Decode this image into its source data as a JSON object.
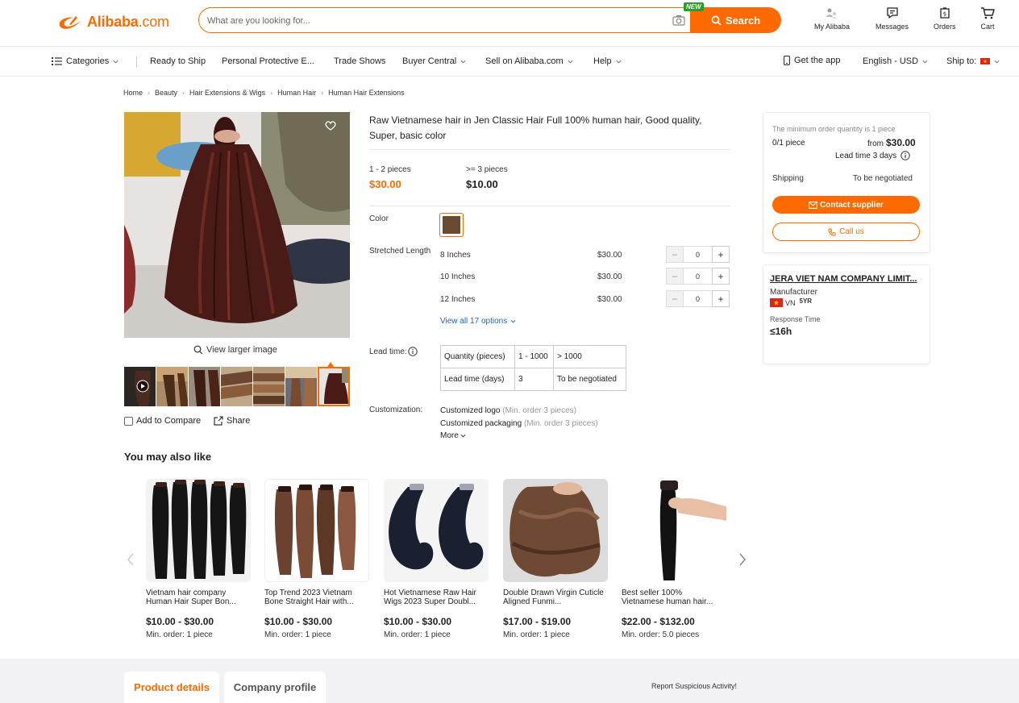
{
  "header": {
    "logo_main": "Alibaba",
    "logo_suffix": ".com",
    "search_placeholder": "What are you looking for...",
    "new_badge": "NEW",
    "search_button": "Search",
    "my_alibaba": "My Alibaba",
    "messages": "Messages",
    "orders": "Orders",
    "cart": "Cart"
  },
  "nav": {
    "categories": "Categories",
    "ready_to_ship": "Ready to Ship",
    "ppe": "Personal Protective E...",
    "trade_shows": "Trade Shows",
    "buyer_central": "Buyer Central",
    "sell": "Sell on Alibaba.com",
    "help": "Help",
    "get_app": "Get the app",
    "language": "English - USD",
    "ship_to": "Ship to:"
  },
  "breadcrumb": [
    "Home",
    "Beauty",
    "Hair Extensions & Wigs",
    "Human Hair",
    "Human Hair Extensions"
  ],
  "product": {
    "title": "Raw Vietnamese hair in Jen Classic Hair Full 100% human hair, Good quality, Super, basic color",
    "view_larger": "View larger image",
    "add_to_compare": "Add to Compare",
    "share": "Share",
    "tiers": [
      {
        "range": "1 - 2 pieces",
        "price": "$30.00"
      },
      {
        "range": ">= 3 pieces",
        "price": "$10.00"
      }
    ],
    "color_label": "Color",
    "length_label": "Stretched Length",
    "variants": [
      {
        "name": "8 Inches",
        "price": "$30.00",
        "qty": "0"
      },
      {
        "name": "10 Inches",
        "price": "$30.00",
        "qty": "0"
      },
      {
        "name": "12 Inches",
        "price": "$30.00",
        "qty": "0"
      }
    ],
    "view_all": "View all 17 options",
    "lead_time_label": "Lead time:",
    "lead_table": [
      [
        "Quantity (pieces)",
        "1 - 1000",
        "> 1000"
      ],
      [
        "Lead time (days)",
        "3",
        "To be negotiated"
      ]
    ],
    "customization_label": "Customization:",
    "customization": [
      {
        "name": "Customized logo",
        "min": "(Min. order 3 pieces)"
      },
      {
        "name": "Customized packaging",
        "min": "(Min. order 3 pieces)"
      }
    ],
    "more": "More"
  },
  "order_card": {
    "moq_note": "The minimum order quantity is 1 piece",
    "qty": "0/1 piece",
    "from_label": "from",
    "from_price": "$30.00",
    "lead_time": "Lead time 3 days",
    "shipping_label": "Shipping",
    "shipping_value": "To be negotiated",
    "contact": "Contact supplier",
    "call": "Call us"
  },
  "supplier": {
    "name": "JERA VIET NAM COMPANY LIMIT...",
    "type": "Manufacturer",
    "country": "VN",
    "years": "5YR",
    "response_label": "Response Time",
    "response_value": "≤16h"
  },
  "recommendations": {
    "title": "You may also like",
    "items": [
      {
        "title": "Vietnam hair company Human Hair Super Bon...",
        "price": "$10.00 - $30.00",
        "moq": "Min. order: 1 piece"
      },
      {
        "title": "Top Trend 2023 Vietnam Bone Straight Hair with...",
        "price": "$10.00 - $30.00",
        "moq": "Min. order: 1 piece"
      },
      {
        "title": "Hot Vietnamese Raw Hair Wigs 2023 Super Doubl...",
        "price": "$10.00 - $30.00",
        "moq": "Min. order: 1 piece"
      },
      {
        "title": "Double Drawn Virgin Cuticle Aligned Funmi...",
        "price": "$17.00 - $19.00",
        "moq": "Min. order: 1 piece"
      },
      {
        "title": "Best seller 100% Vietnamese human hair...",
        "price": "$22.00 - $132.00",
        "moq": "Min. order: 5.0 pieces"
      }
    ]
  },
  "bottom": {
    "tab_details": "Product details",
    "tab_company": "Company profile",
    "report": "Report Suspicious Activity!"
  },
  "colors": {
    "accent": "#ff6a00",
    "link": "#1a66c6",
    "hair_swatch": "#6b4a32"
  }
}
